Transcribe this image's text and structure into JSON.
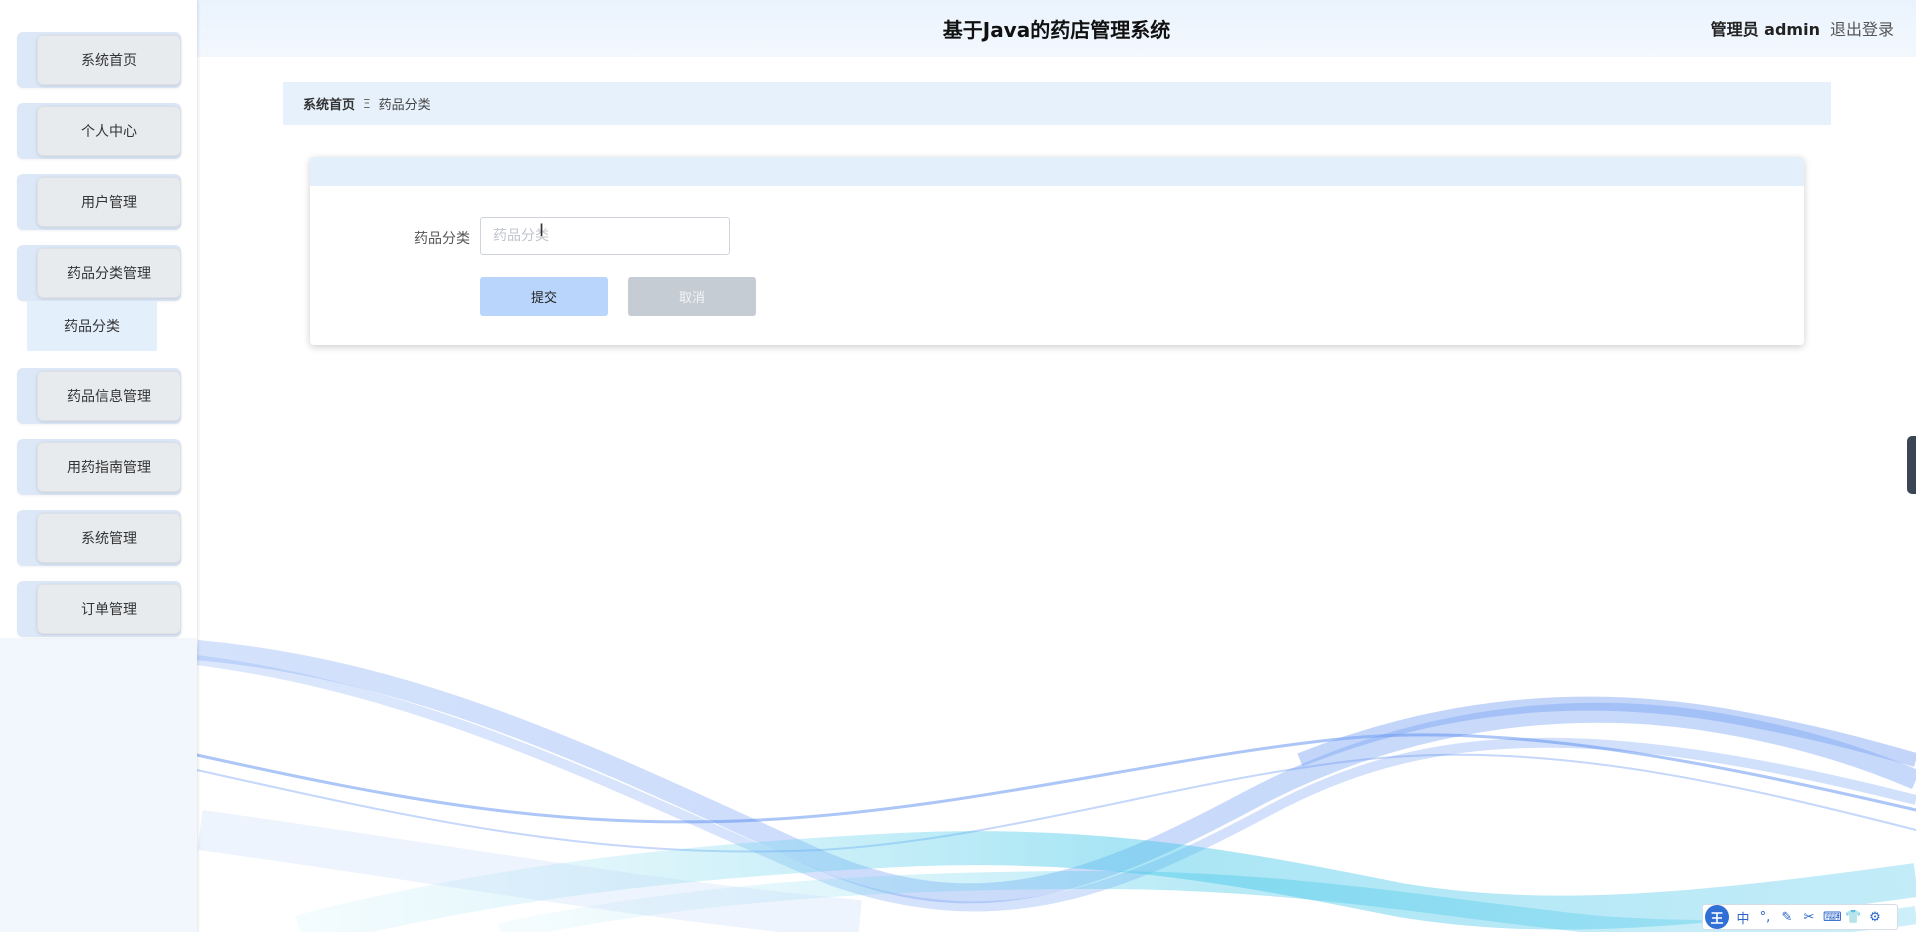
{
  "header": {
    "title": "基于Java的药店管理系统",
    "user_role": "管理员 admin",
    "logout": "退出登录"
  },
  "sidebar": {
    "items": [
      {
        "label": "系统首页"
      },
      {
        "label": "个人中心"
      },
      {
        "label": "用户管理"
      },
      {
        "label": "药品分类管理"
      },
      {
        "label": "药品信息管理"
      },
      {
        "label": "用药指南管理"
      },
      {
        "label": "系统管理"
      },
      {
        "label": "订单管理"
      }
    ],
    "submenu_active": "药品分类"
  },
  "breadcrumb": {
    "home": "系统首页",
    "separator": "Ξ",
    "current": "药品分类"
  },
  "form": {
    "label": "药品分类",
    "value": "",
    "placeholder": "药品分类",
    "submit": "提交",
    "cancel": "取消"
  },
  "ime": {
    "logo": "王",
    "mode": "中",
    "tools": [
      "punctuation-icon",
      "pen-icon",
      "scissors-icon",
      "keyboard-icon",
      "shirt-icon",
      "gear-icon"
    ]
  },
  "colors": {
    "sidebar_bg": "#f1f7fd",
    "header_bg": "#eaf3fd",
    "submit_bg": "#b9d5fb",
    "cancel_bg": "#c6ccd4",
    "wave_blue": "#5a8ef0",
    "wave_cyan": "#3fc6e8"
  }
}
